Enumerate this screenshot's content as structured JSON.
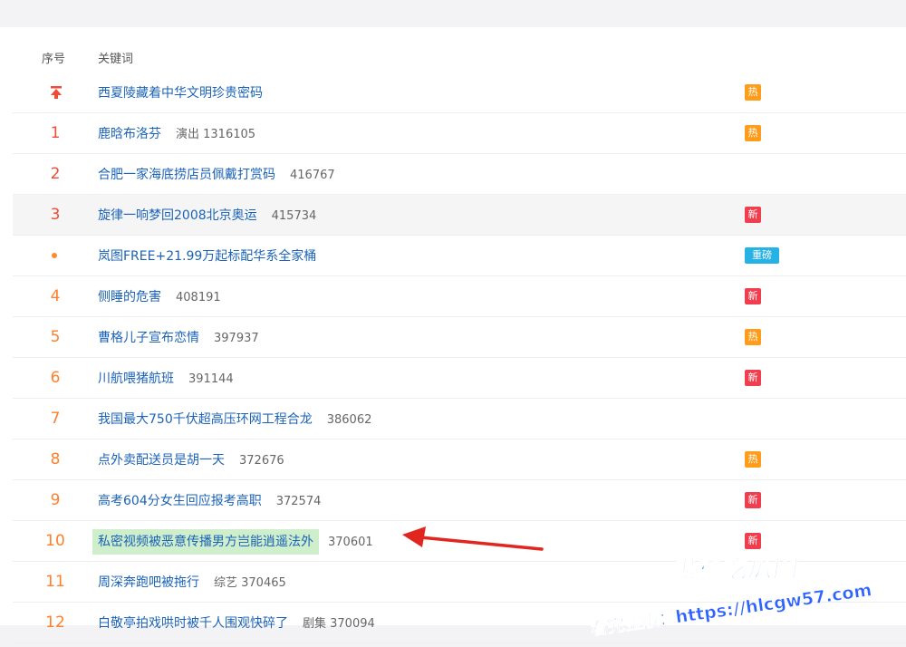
{
  "table": {
    "header": {
      "rank": "序号",
      "keyword": "关键词"
    },
    "rows": [
      {
        "rank": "",
        "rank_icon": "pin-top-icon",
        "keyword": "西夏陵藏着中华文明珍贵密码",
        "meta": "",
        "badge": "热"
      },
      {
        "rank": "1",
        "keyword": "鹿晗布洛芬",
        "meta": "演出 1316105",
        "badge": "热"
      },
      {
        "rank": "2",
        "keyword": "合肥一家海底捞店员佩戴打赏码",
        "meta": "416767",
        "badge": ""
      },
      {
        "rank": "3",
        "keyword": "旋律一响梦回2008北京奥运",
        "meta": "415734",
        "badge": "新"
      },
      {
        "rank": "",
        "rank_icon": "dot-icon",
        "keyword": "岚图FREE+21.99万起标配华系全家桶",
        "meta": "",
        "badge": "重磅"
      },
      {
        "rank": "4",
        "keyword": "侧睡的危害",
        "meta": "408191",
        "badge": "新"
      },
      {
        "rank": "5",
        "keyword": "曹格儿子宣布恋情",
        "meta": "397937",
        "badge": "热"
      },
      {
        "rank": "6",
        "keyword": "川航喂猪航班",
        "meta": "391144",
        "badge": "新"
      },
      {
        "rank": "7",
        "keyword": "我国最大750千伏超高压环网工程合龙",
        "meta": "386062",
        "badge": ""
      },
      {
        "rank": "8",
        "keyword": "点外卖配送员是胡一天",
        "meta": "372676",
        "badge": "热"
      },
      {
        "rank": "9",
        "keyword": "高考604分女生回应报考高职",
        "meta": "372574",
        "badge": "新"
      },
      {
        "rank": "10",
        "keyword": "私密视频被恶意传播男方岂能逍遥法外",
        "meta": "370601",
        "badge": "新",
        "highlight": true
      },
      {
        "rank": "11",
        "keyword": "周深奔跑吧被拖行",
        "meta": "综艺 370465",
        "badge": ""
      },
      {
        "rank": "12",
        "keyword": "白敬亭拍戏哄时被千人围观快碎了",
        "meta": "剧集 370094",
        "badge": ""
      }
    ]
  },
  "badge_colors": {
    "热": "#ff9c1a",
    "新": "#f03e4e",
    "重磅": "#27b2e6"
  },
  "colors": {
    "keyword": "#1b63b8",
    "rank_top": "#f24a35",
    "rank": "#ff7f2a",
    "arrow": "#e0261f",
    "highlight": "#cfeecb"
  },
  "watermark": {
    "brand": "黑料吃瓜网",
    "line": "看完整版：https://hlcgw57.com"
  }
}
